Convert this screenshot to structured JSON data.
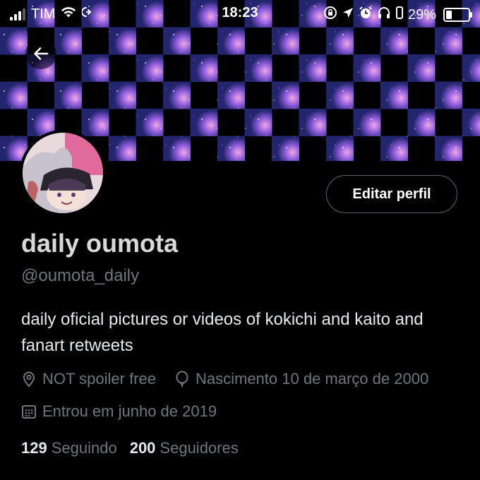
{
  "status_bar": {
    "carrier": "TIM",
    "time": "18:23",
    "battery_percent": "29%",
    "battery_level": 0.29
  },
  "colors": {
    "banner_purple": "#7a4fd8",
    "banner_pink": "#c77bd8",
    "banner_blue": "#3b3fa8",
    "muted_text": "#71767b",
    "button_border": "#536471"
  },
  "header": {
    "back_icon": "arrow-left-icon"
  },
  "profile": {
    "edit_button_label": "Editar perfil",
    "display_name": "daily oumota",
    "handle": "@oumota_daily",
    "bio": "daily oficial pictures or videos of kokichi and kaito and fanart retweets",
    "location": "NOT spoiler free",
    "birthday": "Nascimento 10 de março de 2000",
    "joined": "Entrou em junho de 2019",
    "following_count": "129",
    "following_label": "Seguindo",
    "followers_count": "200",
    "followers_label": "Seguidores"
  }
}
